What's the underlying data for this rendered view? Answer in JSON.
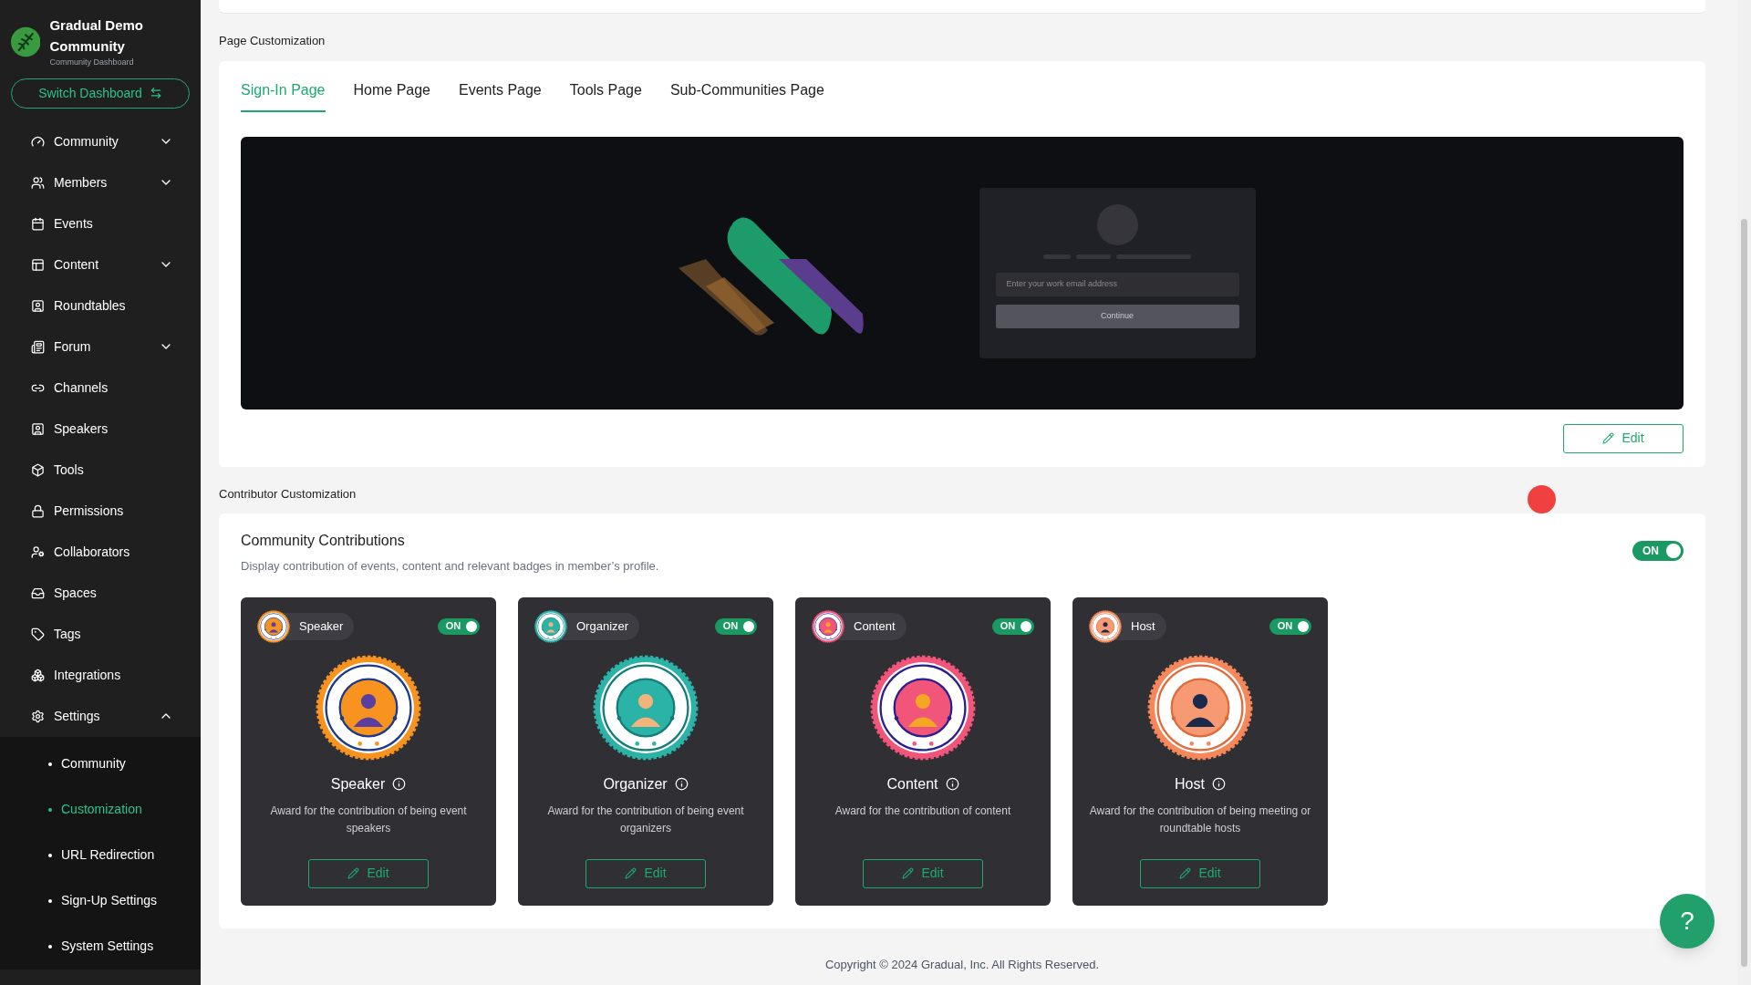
{
  "brand": {
    "name": "Gradual Demo Community",
    "subtitle": "Community Dashboard",
    "switch_label": "Switch Dashboard"
  },
  "sidebar": {
    "items": [
      {
        "label": "Community",
        "kind": "group",
        "expanded": false
      },
      {
        "label": "Members",
        "kind": "group",
        "expanded": false
      },
      {
        "label": "Events",
        "kind": "link"
      },
      {
        "label": "Content",
        "kind": "group",
        "expanded": false
      },
      {
        "label": "Roundtables",
        "kind": "link"
      },
      {
        "label": "Forum",
        "kind": "group",
        "expanded": false
      },
      {
        "label": "Channels",
        "kind": "link"
      },
      {
        "label": "Speakers",
        "kind": "link"
      },
      {
        "label": "Tools",
        "kind": "link"
      },
      {
        "label": "Permissions",
        "kind": "link"
      },
      {
        "label": "Collaborators",
        "kind": "link"
      },
      {
        "label": "Spaces",
        "kind": "link"
      },
      {
        "label": "Tags",
        "kind": "link"
      },
      {
        "label": "Integrations",
        "kind": "link"
      },
      {
        "label": "Settings",
        "kind": "group",
        "expanded": true,
        "children": [
          {
            "label": "Community",
            "selected": false
          },
          {
            "label": "Customization",
            "selected": true
          },
          {
            "label": "URL Redirection",
            "selected": false
          },
          {
            "label": "Sign-Up Settings",
            "selected": false
          },
          {
            "label": "System Settings",
            "selected": false
          }
        ]
      }
    ]
  },
  "page_customization": {
    "heading": "Page Customization",
    "tabs": [
      {
        "label": "Sign-In Page",
        "selected": true
      },
      {
        "label": "Home Page",
        "selected": false
      },
      {
        "label": "Events Page",
        "selected": false
      },
      {
        "label": "Tools Page",
        "selected": false
      },
      {
        "label": "Sub-Communities Page",
        "selected": false
      }
    ],
    "preview": {
      "email_placeholder": "Enter your work email address",
      "continue_label": "Continue"
    },
    "edit_label": "Edit"
  },
  "contributor_customization": {
    "heading": "Contributor Customization",
    "title": "Community Contributions",
    "description": "Display contribution of events, content and relevant badges in member’s profile.",
    "toggle_label": "ON",
    "on": true,
    "cards": [
      {
        "kind": "speaker",
        "tag": "Speaker",
        "toggle_label": "ON",
        "on": true,
        "title": "Speaker",
        "description": "Award for the contribution of being event speakers",
        "edit_label": "Edit"
      },
      {
        "kind": "organizer",
        "tag": "Organizer",
        "toggle_label": "ON",
        "on": true,
        "title": "Organizer",
        "description": "Award for the contribution of being event organizers",
        "edit_label": "Edit"
      },
      {
        "kind": "content",
        "tag": "Content",
        "toggle_label": "ON",
        "on": true,
        "title": "Content",
        "description": "Award for the contribution of content",
        "edit_label": "Edit"
      },
      {
        "kind": "host",
        "tag": "Host",
        "toggle_label": "ON",
        "on": true,
        "title": "Host",
        "description": "Award for the contribution of being meeting or roundtable hosts",
        "edit_label": "Edit"
      }
    ]
  },
  "footer": {
    "copyright": "Copyright © 2024 Gradual, Inc. All Rights Reserved."
  },
  "help_label": "?"
}
